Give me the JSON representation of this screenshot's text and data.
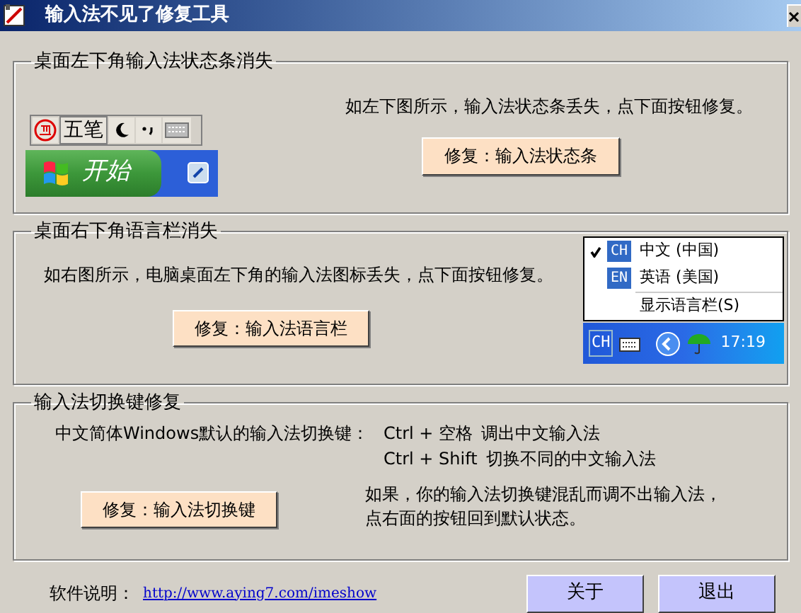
{
  "window": {
    "title": "输入法不见了修复工具"
  },
  "status_bar_section": {
    "title": "桌面左下角输入法状态条消失",
    "description": "如左下图所示，输入法状态条丢失，点下面按钮修复。",
    "button": "修复：输入法状态条",
    "ime_bar": {
      "mode": "五笔"
    },
    "start_button": "开始"
  },
  "language_bar_section": {
    "title": "桌面右下角语言栏消失",
    "description": "如右图所示，电脑桌面左下角的输入法图标丢失，点下面按钮修复。",
    "button": "修复：输入法语言栏",
    "menu": [
      {
        "kind": "language",
        "code": "CH",
        "label": "中文 (中国)",
        "checked": true
      },
      {
        "kind": "language",
        "code": "EN",
        "label": "英语 (美国)",
        "checked": false
      },
      {
        "kind": "command",
        "label": "显示语言栏(S)"
      }
    ],
    "tray": {
      "code": "CH",
      "time": "17:19"
    }
  },
  "hotkey_section": {
    "title": "输入法切换键修复",
    "intro": "中文简体Windows默认的输入法切换键：",
    "hotkeys": [
      {
        "keys": "Ctrl + 空格",
        "action": "调出中文输入法"
      },
      {
        "keys": "Ctrl + Shift",
        "action": "切换不同的中文输入法"
      }
    ],
    "button": "修复：输入法切换键",
    "note": [
      "如果，你的输入法切换键混乱而调不出输入法，",
      "点右面的按钮回到默认状态。"
    ]
  },
  "footer": {
    "label": "软件说明：",
    "link": "http://www.aying7.com/imeshow",
    "buttons": [
      "关于",
      "退出"
    ]
  }
}
